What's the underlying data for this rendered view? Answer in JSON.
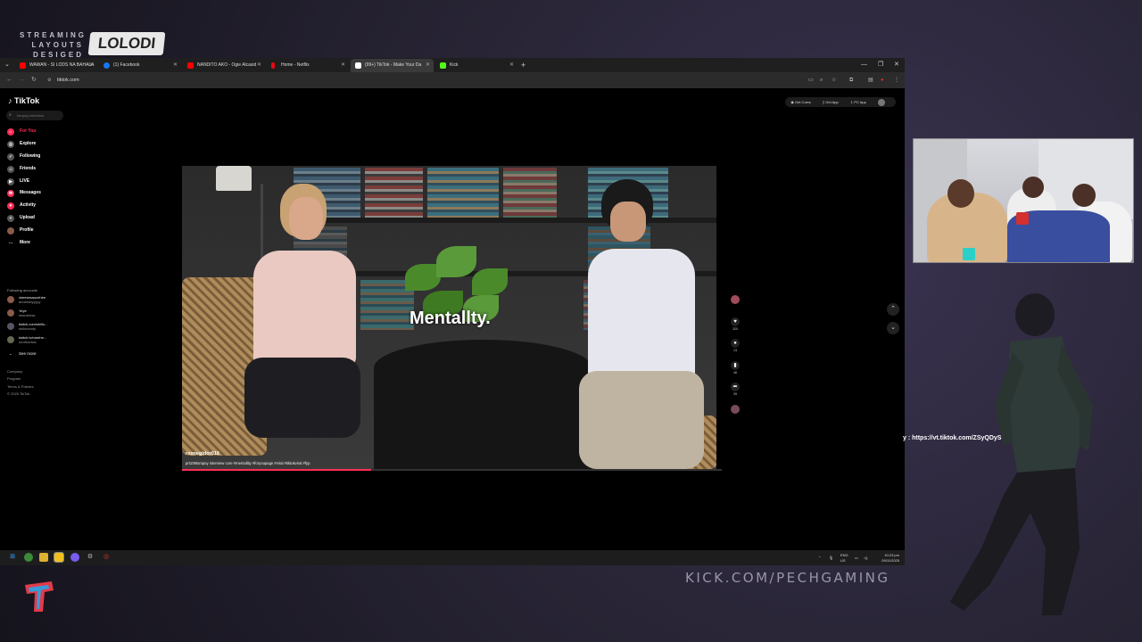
{
  "overlay": {
    "brand_line1": "STREAMING",
    "brand_line2": "LAYOUTS",
    "brand_line3": "DESIGED BY",
    "brand_logo": "LOLODI",
    "stream_link": "y : https://vt.tiktok.com/ZSyQDySYP/",
    "channel_url": "KICK.COM/PECHGAMING"
  },
  "browser": {
    "tabs": [
      {
        "label": "WAWAN - SI LODS NA BAHALA",
        "color": "#ff0000"
      },
      {
        "label": "(1) Facebook",
        "color": "#1877f2"
      },
      {
        "label": "NANDITO AKO - Ogie Alcasid",
        "color": "#ff0000"
      },
      {
        "label": "Home - Netflix",
        "color": "#e50914"
      },
      {
        "label": "(99+) TikTok - Make Your Da",
        "color": "#ffffff"
      },
      {
        "label": "Kick",
        "color": "#53fc18"
      }
    ],
    "new_tab": "+",
    "url": "tiktok.com"
  },
  "tiktok": {
    "logo": "TikTok",
    "search_placeholder": "tompoy interview",
    "nav": [
      {
        "label": "For You",
        "icon": "home-icon"
      },
      {
        "label": "Explore",
        "icon": "compass-icon"
      },
      {
        "label": "Following",
        "icon": "following-icon"
      },
      {
        "label": "Friends",
        "icon": "friends-icon"
      },
      {
        "label": "LIVE",
        "icon": "live-icon"
      },
      {
        "label": "Messages",
        "icon": "messages-icon"
      },
      {
        "label": "Activity",
        "icon": "activity-icon"
      },
      {
        "label": "Upload",
        "icon": "upload-icon"
      },
      {
        "label": "Profile",
        "icon": "profile-icon"
      },
      {
        "label": "More",
        "icon": "more-icon"
      }
    ],
    "following_title": "Following accounts",
    "accounts": [
      {
        "name": "ckeesesaucehire",
        "sub": "annetobyyyyy"
      },
      {
        "name": "Yeye",
        "sub": "imamerlas"
      },
      {
        "name": "twitch.com/shillo...",
        "sub": "shilomonty"
      },
      {
        "name": "twitch.tv/omehe...",
        "sub": "neothorilas"
      }
    ],
    "see_more": "See more",
    "footer": [
      "Company",
      "Program",
      "Terms & Policies",
      "© 2025 TikTok"
    ],
    "top_buttons": {
      "coins": "Get Coins",
      "app": "Get App",
      "pc": "PC App"
    },
    "video": {
      "caption": "Mentallty.",
      "username": "roxnegldor016",
      "description": "prt109tompoy interview core #mentallity #foryoupage #viral #tiktokviral #fyp"
    },
    "actions": [
      {
        "icon": "avatar-icon",
        "count": ""
      },
      {
        "icon": "heart-icon",
        "count": "320"
      },
      {
        "icon": "comment-icon",
        "count": "13"
      },
      {
        "icon": "bookmark-icon",
        "count": "46"
      },
      {
        "icon": "share-icon",
        "count": "39"
      },
      {
        "icon": "sound-icon",
        "count": ""
      }
    ],
    "progress": 0.35
  },
  "taskbar": {
    "lang": "ENG",
    "region": "US",
    "time": "10:23 pm",
    "date": "09/11/2025"
  }
}
